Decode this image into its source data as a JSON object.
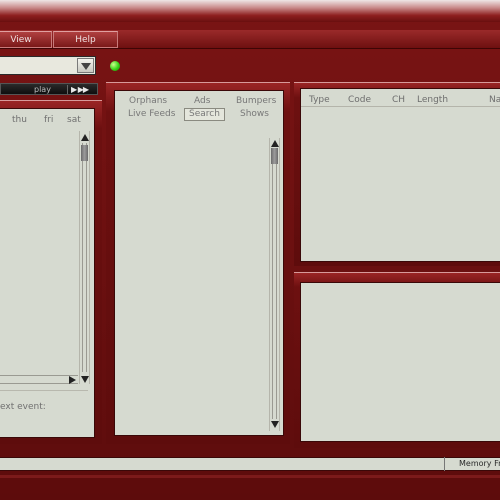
{
  "menu": {
    "items": [
      {
        "label": "View"
      },
      {
        "label": "Help"
      }
    ]
  },
  "combo": {
    "selected": ""
  },
  "status_led": {
    "color": "#36d316"
  },
  "transport": {
    "play_label": "play",
    "controls": "▶ ▶▶"
  },
  "calendar": {
    "days": [
      "thu",
      "fri",
      "sat"
    ],
    "next_event_label": "ext event:"
  },
  "library": {
    "tabs": [
      "Orphans",
      "Ads",
      "Bumpers",
      "Live Feeds",
      "Search",
      "Shows"
    ],
    "active_tab": "Search"
  },
  "metadata": {
    "columns": [
      "Type",
      "Code",
      "CH",
      "Length",
      "Na"
    ]
  },
  "status": {
    "memory_label": "Memory Fr"
  },
  "colors": {
    "frame": "#6d1010",
    "panel": "#d6dad0",
    "led": "#36d316"
  }
}
